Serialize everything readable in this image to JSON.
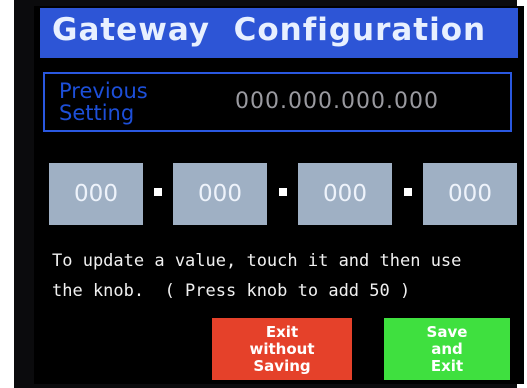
{
  "title": "Gateway  Configuration",
  "previous": {
    "label_line1": "Previous",
    "label_line2": "Setting",
    "value": "000.000.000.000"
  },
  "octets": [
    "000",
    "000",
    "000",
    "000"
  ],
  "instructions": {
    "line1": "To update a value, touch it and then use",
    "line2": "the knob.  ( Press knob to add 50 )"
  },
  "buttons": {
    "exit": {
      "line1": "Exit",
      "line2": "without",
      "line3": "Saving",
      "color": "#e5412a"
    },
    "save": {
      "line1": "Save",
      "line2": "and",
      "line3": "Exit",
      "color": "#3fe03f"
    }
  },
  "colors": {
    "title_bar": "#2d55d6",
    "accent_border": "#2a58e0",
    "octet_bg": "#9fb0c4"
  }
}
